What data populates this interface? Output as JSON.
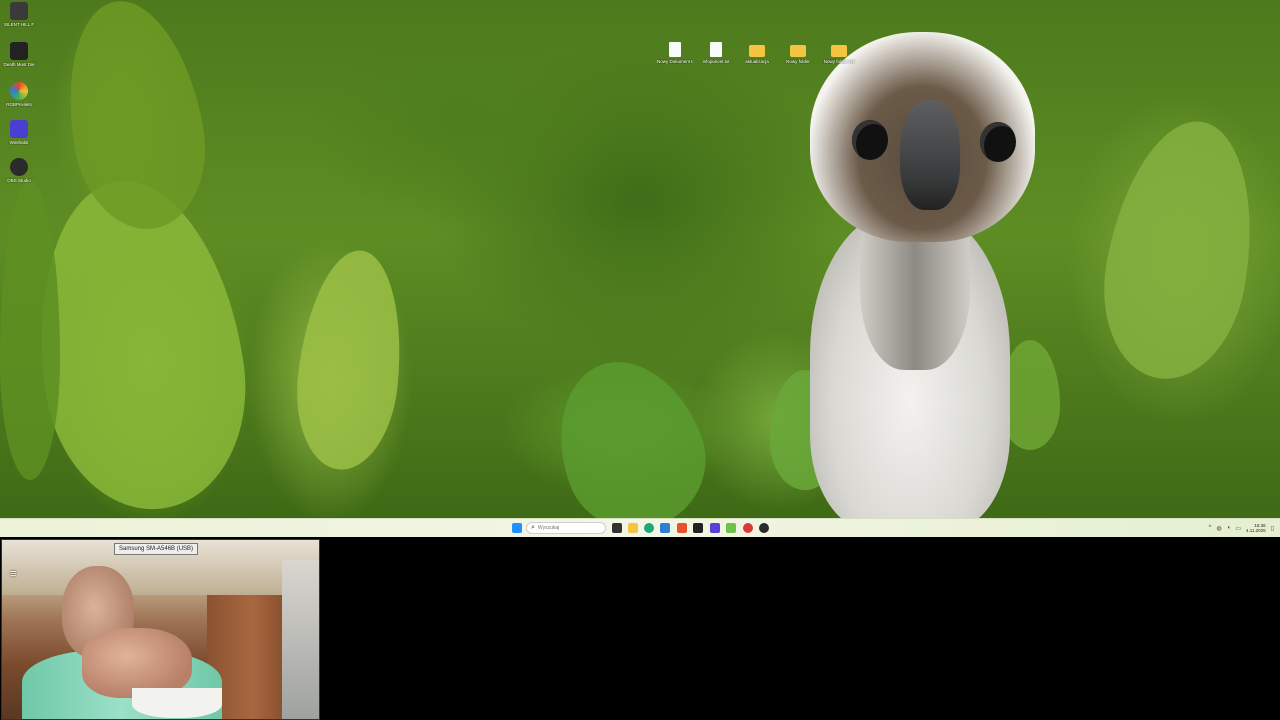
{
  "desktop": {
    "left_icons": [
      {
        "label": "SILENT HILL F",
        "icon": "game-icon",
        "color": "#3a3a3a"
      },
      {
        "label": "Death Must Die",
        "icon": "game-icon",
        "color": "#222222"
      },
      {
        "label": "RGBPrivilets",
        "icon": "rgb-app-icon",
        "color": "#e04a2a"
      },
      {
        "label": "Winthabit",
        "icon": "app-icon",
        "color": "#4a3fd0"
      },
      {
        "label": "OBS Studio",
        "icon": "obs-icon",
        "color": "#2b2b2b"
      }
    ],
    "top_icons": [
      {
        "label": "Nowy Dokument tekstowy.txt",
        "icon": "text-file-icon"
      },
      {
        "label": "infopuncet.txt",
        "icon": "text-file-icon"
      },
      {
        "label": "aktualizacja",
        "icon": "folder-icon"
      },
      {
        "label": "Nowy folder",
        "icon": "folder-icon"
      },
      {
        "label": "Nowy folder (2)",
        "icon": "folder-icon"
      }
    ]
  },
  "taskbar": {
    "search_placeholder": "Wyszukaj",
    "pinned": [
      {
        "name": "start-button",
        "icon": "windows-icon",
        "color": "#1e90ff"
      },
      {
        "name": "taskview-button",
        "icon": "taskview-icon",
        "color": "#333333"
      },
      {
        "name": "file-explorer-button",
        "icon": "folder-icon",
        "color": "#f4c542"
      },
      {
        "name": "edge-button",
        "icon": "edge-icon",
        "color": "#1fa67a"
      },
      {
        "name": "store-button",
        "icon": "store-icon",
        "color": "#2d7fd3"
      },
      {
        "name": "brave-button",
        "icon": "brave-icon",
        "color": "#e5532d"
      },
      {
        "name": "terminal-button",
        "icon": "terminal-icon",
        "color": "#222222"
      },
      {
        "name": "app-purple-button",
        "icon": "app-icon",
        "color": "#5b3fd6"
      },
      {
        "name": "notepad-button",
        "icon": "notepad-icon",
        "color": "#6cc24a"
      },
      {
        "name": "app-red-button",
        "icon": "app-icon",
        "color": "#d63a3a"
      },
      {
        "name": "obs-button",
        "icon": "obs-icon",
        "color": "#2b2b2b"
      }
    ],
    "tray": {
      "chevron": "^",
      "clock_time": "15:36",
      "clock_date": "4.11.2025"
    }
  },
  "webcam": {
    "device_label": "Samsung SM-A546B (USB)",
    "menu_glyph": "≡"
  }
}
